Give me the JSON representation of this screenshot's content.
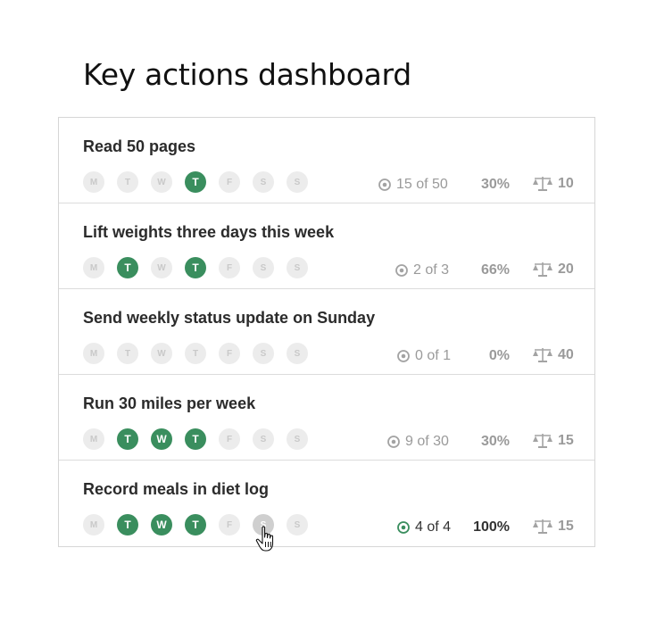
{
  "page_title": "Key actions dashboard",
  "colors": {
    "done": "#3a8e5e",
    "idle": "#ececec",
    "hover": "#cfcfcf",
    "text_muted": "#9a9a9a"
  },
  "actions": [
    {
      "title": "Read 50 pages",
      "days": [
        {
          "l": "M",
          "s": "idle"
        },
        {
          "l": "T",
          "s": "idle"
        },
        {
          "l": "W",
          "s": "idle"
        },
        {
          "l": "T",
          "s": "done"
        },
        {
          "l": "F",
          "s": "idle"
        },
        {
          "l": "S",
          "s": "idle"
        },
        {
          "l": "S",
          "s": "idle"
        }
      ],
      "progress": "15 of 50",
      "percent": "30%",
      "weight": "10",
      "complete": false
    },
    {
      "title": "Lift weights three days this week",
      "days": [
        {
          "l": "M",
          "s": "idle"
        },
        {
          "l": "T",
          "s": "done"
        },
        {
          "l": "W",
          "s": "idle"
        },
        {
          "l": "T",
          "s": "done"
        },
        {
          "l": "F",
          "s": "idle"
        },
        {
          "l": "S",
          "s": "idle"
        },
        {
          "l": "S",
          "s": "idle"
        }
      ],
      "progress": "2 of 3",
      "percent": "66%",
      "weight": "20",
      "complete": false
    },
    {
      "title": "Send weekly status update on Sunday",
      "days": [
        {
          "l": "M",
          "s": "idle"
        },
        {
          "l": "T",
          "s": "idle"
        },
        {
          "l": "W",
          "s": "idle"
        },
        {
          "l": "T",
          "s": "idle"
        },
        {
          "l": "F",
          "s": "idle"
        },
        {
          "l": "S",
          "s": "idle"
        },
        {
          "l": "S",
          "s": "idle"
        }
      ],
      "progress": "0 of 1",
      "percent": "0%",
      "weight": "40",
      "complete": false
    },
    {
      "title": "Run 30 miles per week",
      "days": [
        {
          "l": "M",
          "s": "idle"
        },
        {
          "l": "T",
          "s": "done"
        },
        {
          "l": "W",
          "s": "done"
        },
        {
          "l": "T",
          "s": "done"
        },
        {
          "l": "F",
          "s": "idle"
        },
        {
          "l": "S",
          "s": "idle"
        },
        {
          "l": "S",
          "s": "idle"
        }
      ],
      "progress": "9 of 30",
      "percent": "30%",
      "weight": "15",
      "complete": false
    },
    {
      "title": "Record meals in diet log",
      "days": [
        {
          "l": "M",
          "s": "idle"
        },
        {
          "l": "T",
          "s": "done"
        },
        {
          "l": "W",
          "s": "done"
        },
        {
          "l": "T",
          "s": "done"
        },
        {
          "l": "F",
          "s": "idle"
        },
        {
          "l": "S",
          "s": "hover"
        },
        {
          "l": "S",
          "s": "idle"
        }
      ],
      "progress": "4 of 4",
      "percent": "100%",
      "weight": "15",
      "complete": true
    }
  ]
}
